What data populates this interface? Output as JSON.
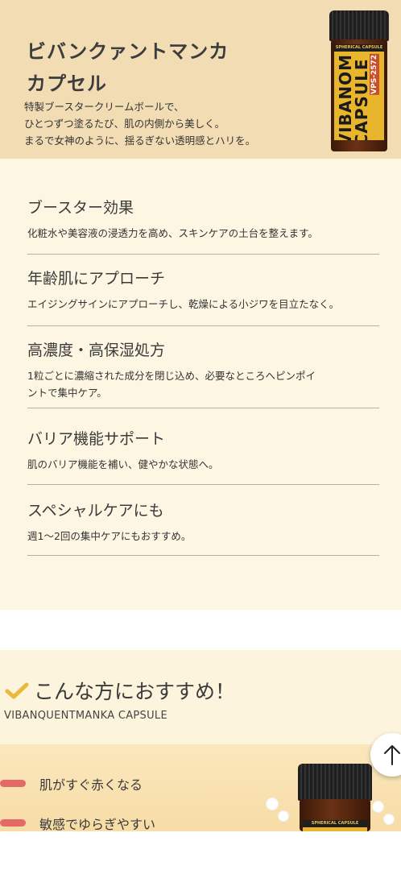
{
  "hero": {
    "title_lines": [
      "ビバンクァントマンカ",
      "カプセル"
    ],
    "desc_lines": [
      "特製ブースタークリームボールで、",
      "ひとつずつ塗るたび、肌の内側から美しく。",
      "まるで女神のように、揺るぎない透明感とハリを。"
    ]
  },
  "product_label": {
    "top": "SPHERICAL CAPSULE",
    "name": "VIBANOM CAPSULE",
    "code": "VPS-2572"
  },
  "features": [
    {
      "title": "ブースター効果",
      "desc": [
        "化粧水や美容液の浸透力を高め、スキンケアの土台を整えます。"
      ]
    },
    {
      "title": "年齢肌にアプローチ",
      "desc": [
        "エイジングサインにアプローチし、乾燥による小ジワを目立たなく。"
      ]
    },
    {
      "title": "高濃度・高保湿処方",
      "desc": [
        "1粒ごとに濃縮された成分を閉じ込め、必要なところへピンポイ",
        "ントで集中ケア。"
      ]
    },
    {
      "title": "バリア機能サポート",
      "desc": [
        "肌のバリア機能を補い、健やかな状態へ。"
      ]
    },
    {
      "title": "スペシャルケアにも",
      "desc": [
        "週1〜2回の集中ケアにもおすすめ。"
      ]
    }
  ],
  "recommend": {
    "title": "こんな方におすすめ！",
    "subtitle": "VIBANQUENTMANKA CAPSULE",
    "items": [
      "肌がすぐ赤くなる",
      "敏感でゆらぎやすい"
    ],
    "label_top": "SPHERICAL CAPSULE"
  },
  "colors": {
    "hero_bg": "#f2dcb3",
    "features_bg": "#fdf6e3",
    "accent_check": "#e8b93a",
    "brush_red": "#e36a67"
  }
}
